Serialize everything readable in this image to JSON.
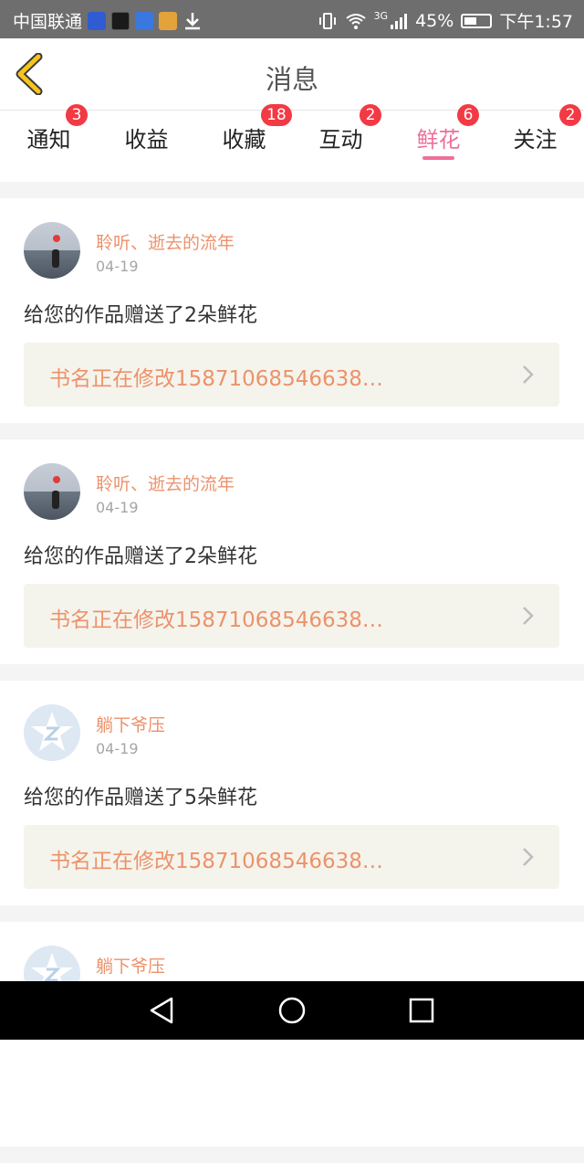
{
  "status_bar": {
    "carrier": "中国联通",
    "signal_label": "3G",
    "battery": "45%",
    "time": "下午1:57"
  },
  "header": {
    "title": "消息"
  },
  "tabs": [
    {
      "label": "通知",
      "badge": "3",
      "active": false
    },
    {
      "label": "收益",
      "badge": "",
      "active": false
    },
    {
      "label": "收藏",
      "badge": "18",
      "active": false
    },
    {
      "label": "互动",
      "badge": "2",
      "active": false
    },
    {
      "label": "鲜花",
      "badge": "6",
      "active": true
    },
    {
      "label": "关注",
      "badge": "2",
      "active": false
    }
  ],
  "feed": [
    {
      "user": "聆听、逝去的流年",
      "time": "04-19",
      "message": "给您的作品赠送了2朵鲜花",
      "book": "书名正在修改15871068546638…",
      "avatar": "photo"
    },
    {
      "user": "聆听、逝去的流年",
      "time": "04-19",
      "message": "给您的作品赠送了2朵鲜花",
      "book": "书名正在修改15871068546638…",
      "avatar": "photo"
    },
    {
      "user": "躺下爷压",
      "time": "04-19",
      "message": "给您的作品赠送了5朵鲜花",
      "book": "书名正在修改15871068546638…",
      "avatar": "default"
    },
    {
      "user": "躺下爷压",
      "time": "",
      "message": "",
      "book": "",
      "avatar": "default"
    }
  ],
  "colors": {
    "accent": "#ee6f9c",
    "badge": "#f23a45",
    "name": "#ec926b",
    "back_icon": "#f5c51c"
  },
  "icons": {
    "back": "chevron-left-icon",
    "nav": [
      "triangle-back-icon",
      "circle-home-icon",
      "square-recents-icon"
    ]
  }
}
